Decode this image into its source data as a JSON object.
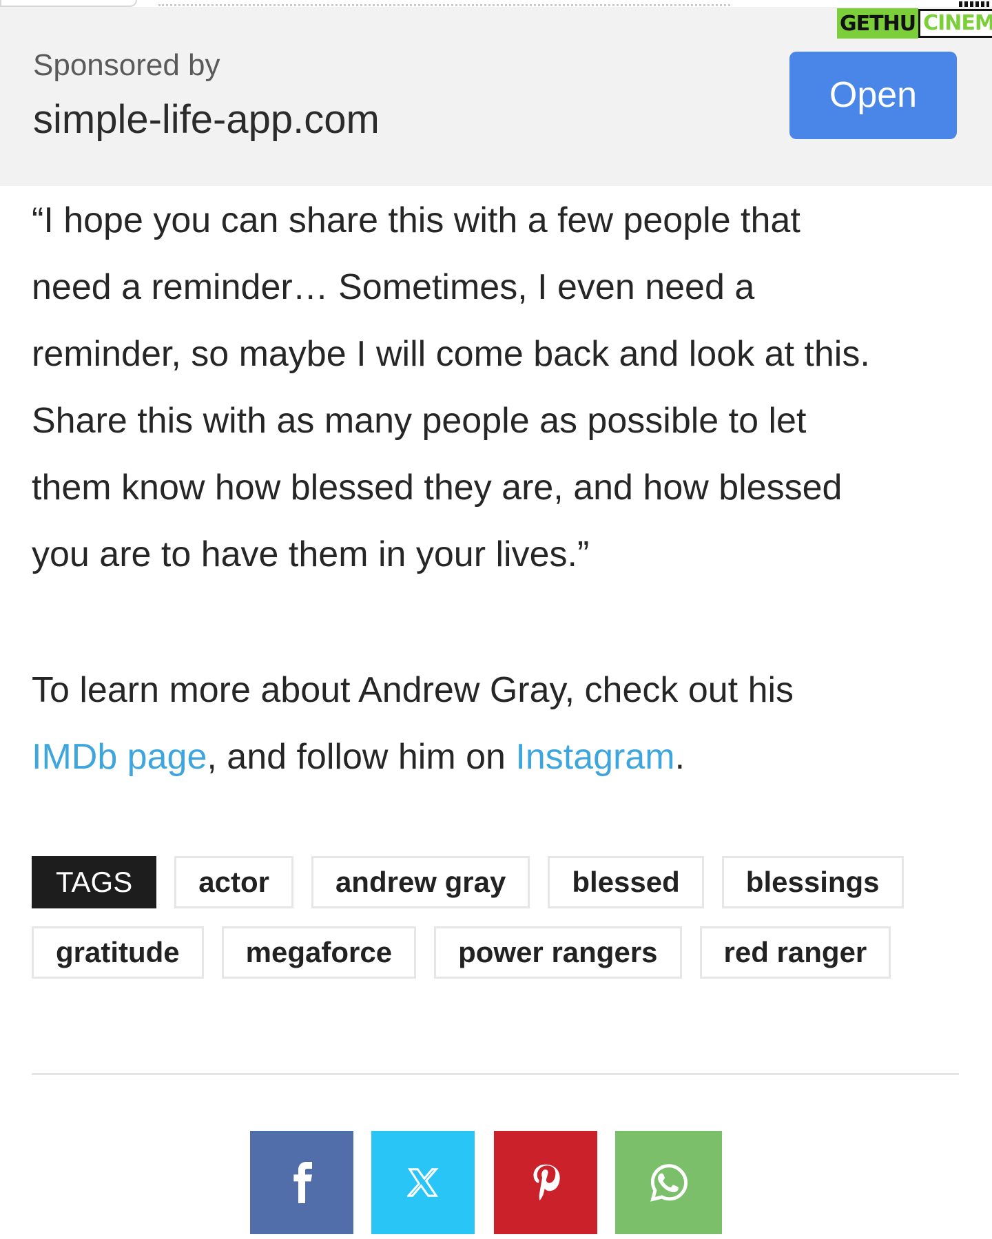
{
  "watermark": {
    "part1": "GETHU",
    "part2": "CINEMA"
  },
  "sponsor": {
    "label": "Sponsored by",
    "domain": "simple-life-app.com",
    "button_label": "Open"
  },
  "article": {
    "quote_lines": [
      "“I hope you can share this with a few people that",
      "need a reminder… Sometimes, I even need a",
      "reminder, so maybe I will come back and look at this.",
      "Share this with as many people as possible to let",
      "them know how blessed they are, and how blessed",
      "you are to have them in your lives.”"
    ],
    "learn_more": {
      "line1": "To learn more about Andrew Gray, check out his",
      "link1": "IMDb page",
      "mid": ", and follow him on ",
      "link2": "Instagram",
      "end": "."
    }
  },
  "tags": {
    "heading": "TAGS",
    "row1": [
      "actor",
      "andrew gray",
      "blessed",
      "blessings"
    ],
    "row2": [
      "gratitude",
      "megaforce",
      "power rangers",
      "red ranger"
    ]
  },
  "share": {
    "icons": [
      "facebook-icon",
      "x-icon",
      "pinterest-icon",
      "whatsapp-icon"
    ],
    "colors": {
      "facebook": "#516eab",
      "x": "#29c5f6",
      "pinterest": "#ca212a",
      "whatsapp": "#7bbf6a"
    }
  },
  "colors": {
    "link": "#3ea6dc",
    "open_button": "#4a86e8",
    "banner_bg": "#f2f2f2",
    "tag_heading_bg": "#1d1d1d"
  }
}
